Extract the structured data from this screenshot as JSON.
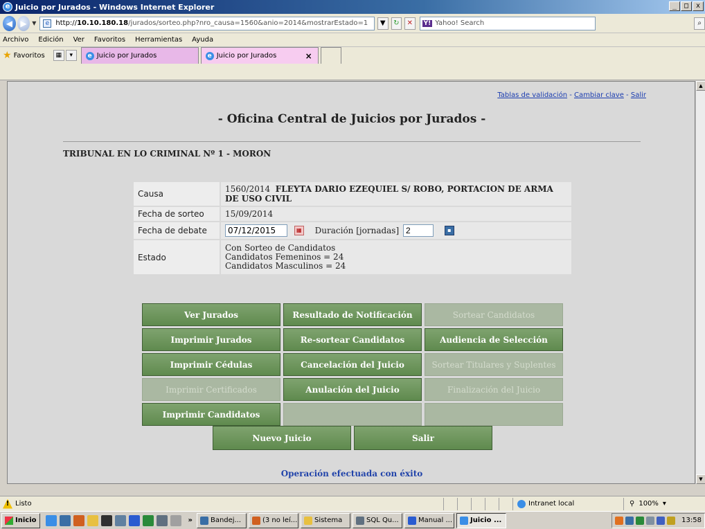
{
  "window": {
    "title": "Juicio por Jurados - Windows Internet Explorer",
    "controls": [
      "_",
      "□",
      "x"
    ]
  },
  "address": {
    "url_prefix": "http://",
    "url_host": "10.10.180.18",
    "url_path": "/jurados/sorteo.php?nro_causa=1560&anio=2014&mostrarEstado=1",
    "search_placeholder": "Yahoo! Search",
    "search_brand": "Y!"
  },
  "menu": [
    "Archivo",
    "Edición",
    "Ver",
    "Favoritos",
    "Herramientas",
    "Ayuda"
  ],
  "favorites": {
    "label": "Favoritos",
    "tabs": [
      {
        "label": "Juicio por Jurados"
      },
      {
        "label": "Juicio por Jurados",
        "close": "×"
      }
    ]
  },
  "page": {
    "toplinks": {
      "tablas": "Tablas de validación",
      "sep1": " - ",
      "cambiar": "Cambiar clave",
      "sep2": " - ",
      "salir": "Salir"
    },
    "title": "- Oficina Central de Juicios por Jurados -",
    "tribunal": "TRIBUNAL EN LO CRIMINAL Nº 1 - MORON",
    "info": {
      "causa_label": "Causa",
      "causa_number": "1560/2014",
      "causa_title": "FLEYTA DARIO EZEQUIEL S/ ROBO, PORTACION DE ARMA DE USO CIVIL",
      "sorteo_label": "Fecha de sorteo",
      "sorteo_value": "15/09/2014",
      "debate_label": "Fecha de debate",
      "debate_value": "07/12/2015",
      "duracion_label": "Duración [jornadas]",
      "duracion_value": "2",
      "estado_label": "Estado",
      "estado_lines": [
        "Con Sorteo de Candidatos",
        "Candidatos Femeninos = 24",
        "Candidatos Masculinos = 24"
      ]
    },
    "buttons": {
      "ver_jurados": "Ver Jurados",
      "resultado_notificacion": "Resultado de Notificación",
      "sortear_candidatos": "Sortear Candidatos",
      "imprimir_jurados": "Imprimir Jurados",
      "re_sortear": "Re-sortear Candidatos",
      "audiencia": "Audiencia de Selección",
      "imprimir_cedulas": "Imprimir Cédulas",
      "cancelacion": "Cancelación del Juicio",
      "sortear_titulares": "Sortear Titulares y Suplentes",
      "imprimir_certificados": "Imprimir Certificados",
      "anulacion": "Anulación del Juicio",
      "finalizacion": "Finalización del Juicio",
      "imprimir_candidatos": "Imprimir Candidatos",
      "nuevo_juicio": "Nuevo Juicio",
      "salir": "Salir"
    },
    "success_message": "Operación efectuada con éxito"
  },
  "status": {
    "text": "Listo",
    "zone": "Intranet local",
    "zoom": "100%"
  },
  "taskbar": {
    "start": "Inicio",
    "chevron": "»",
    "tasks": [
      {
        "label": "Bandej...",
        "color": "#3a6ea5"
      },
      {
        "label": "(3 no leí...",
        "color": "#d06020"
      },
      {
        "label": "Sistema",
        "color": "#e8c040"
      },
      {
        "label": "SQL Qu...",
        "color": "#607080"
      },
      {
        "label": "Manual ...",
        "color": "#2a5bd0"
      },
      {
        "label": "Juicio ...",
        "color": "#3a8ee6"
      }
    ],
    "clock": "13:58"
  }
}
